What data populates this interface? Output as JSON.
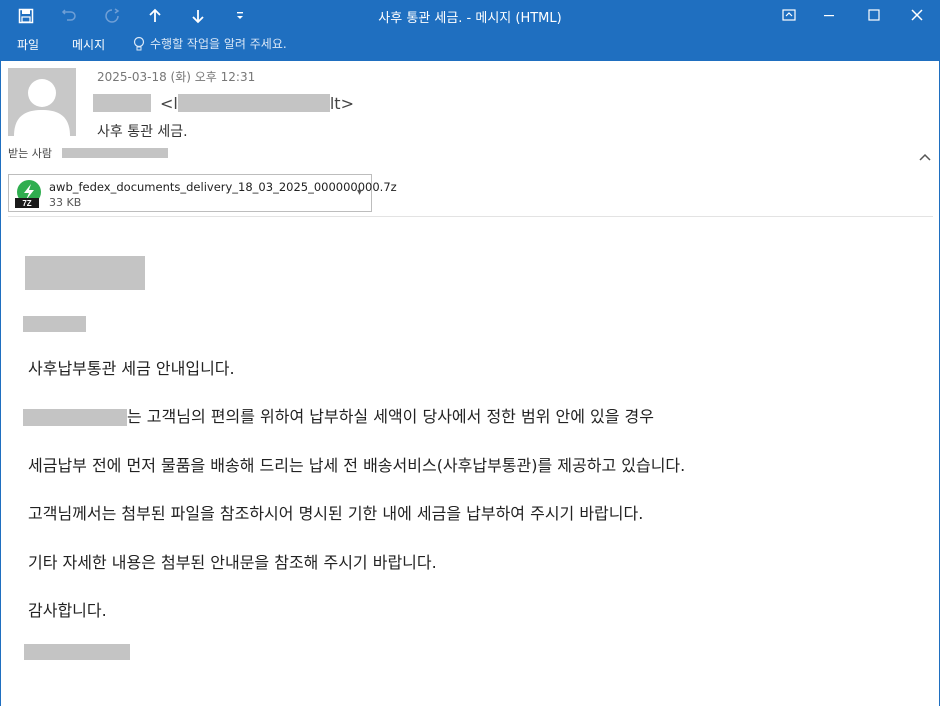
{
  "window": {
    "title": "사후 통관 세금. - 메시지 (HTML)",
    "accent_color": "#1f6fc0"
  },
  "quick_access": [
    "save-icon",
    "undo-icon",
    "redo-icon",
    "previous-item-icon",
    "next-item-icon",
    "customize-icon"
  ],
  "ribbon": {
    "file_tab": "파일",
    "message_tab": "메시지",
    "tell_me": "수행할 작업을 알려 주세요."
  },
  "header": {
    "date": "2025-03-18 (화) 오후 12:31",
    "sender_open": "<l",
    "sender_close": "lt>",
    "subject": "사후 통관 세금.",
    "to_label": "받는 사람"
  },
  "attachment": {
    "icon_label": "7Z",
    "filename": "awb_fedex_documents_delivery_18_03_2025_000000000.7z",
    "size": "33 KB"
  },
  "body": {
    "line1": "사후납부통관 세금 안내입니다.",
    "line2": "는 고객님의 편의를 위하여 납부하실 세액이 당사에서 정한 범위 안에 있을 경우",
    "line3": "세금납부 전에 먼저 물품을 배송해 드리는 납세 전 배송서비스(사후납부통관)를 제공하고 있습니다.",
    "line4": "고객님께서는 첨부된 파일을 참조하시어 명시된 기한 내에 세금을 납부하여 주시기 바랍니다.",
    "line5": "기타 자세한 내용은 첨부된 안내문을 참조해 주시기 바랍니다.",
    "line6": "감사합니다."
  }
}
